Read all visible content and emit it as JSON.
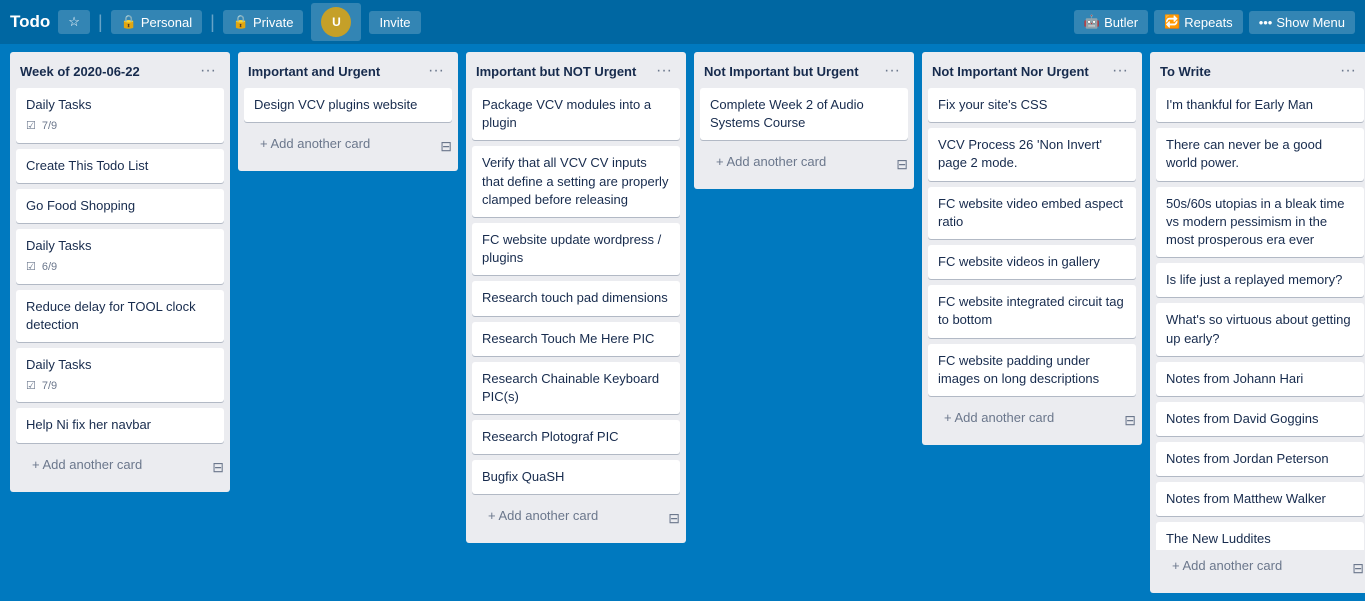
{
  "header": {
    "title": "Todo",
    "star_label": "★",
    "personal_label": "Personal",
    "private_label": "Private",
    "invite_label": "Invite",
    "butler_label": "Butler",
    "repeats_label": "Repeats",
    "show_menu_label": "Show Menu"
  },
  "columns": [
    {
      "id": "week",
      "title": "Week of 2020-06-22",
      "cards": [
        {
          "id": "c1",
          "text": "Daily Tasks",
          "meta": "7/9",
          "has_checklist": true
        },
        {
          "id": "c2",
          "text": "Create This Todo List",
          "meta": null,
          "has_checklist": false
        },
        {
          "id": "c3",
          "text": "Go Food Shopping",
          "meta": null,
          "has_checklist": false
        },
        {
          "id": "c4",
          "text": "Daily Tasks",
          "meta": "6/9",
          "has_checklist": true
        },
        {
          "id": "c5",
          "text": "Reduce delay for TOOL clock detection",
          "meta": null,
          "has_checklist": false
        },
        {
          "id": "c6",
          "text": "Daily Tasks",
          "meta": "7/9",
          "has_checklist": true
        },
        {
          "id": "c7",
          "text": "Help Ni fix her navbar",
          "meta": null,
          "has_checklist": false
        }
      ],
      "add_card_label": "+ Add another card"
    },
    {
      "id": "important-urgent",
      "title": "Important and Urgent",
      "cards": [
        {
          "id": "c8",
          "text": "Design VCV plugins website",
          "meta": null,
          "has_checklist": false
        }
      ],
      "add_card_label": "+ Add another card"
    },
    {
      "id": "important-not-urgent",
      "title": "Important but NOT Urgent",
      "cards": [
        {
          "id": "c9",
          "text": "Package VCV modules into a plugin",
          "meta": null,
          "has_checklist": false
        },
        {
          "id": "c10",
          "text": "Verify that all VCV CV inputs that define a setting are properly clamped before releasing",
          "meta": null,
          "has_checklist": false
        },
        {
          "id": "c11",
          "text": "FC website update wordpress / plugins",
          "meta": null,
          "has_checklist": false
        },
        {
          "id": "c12",
          "text": "Research touch pad dimensions",
          "meta": null,
          "has_checklist": false
        },
        {
          "id": "c13",
          "text": "Research Touch Me Here PIC",
          "meta": null,
          "has_checklist": false
        },
        {
          "id": "c14",
          "text": "Research Chainable Keyboard PIC(s)",
          "meta": null,
          "has_checklist": false
        },
        {
          "id": "c15",
          "text": "Research Plotograf PIC",
          "meta": null,
          "has_checklist": false
        },
        {
          "id": "c16",
          "text": "Bugfix QuaSH",
          "meta": null,
          "has_checklist": false
        }
      ],
      "add_card_label": "+ Add another card"
    },
    {
      "id": "not-important-urgent",
      "title": "Not Important but Urgent",
      "cards": [
        {
          "id": "c17",
          "text": "Complete Week 2 of Audio Systems Course",
          "meta": null,
          "has_checklist": false
        }
      ],
      "add_card_label": "+ Add another card"
    },
    {
      "id": "not-important-not-urgent",
      "title": "Not Important Nor Urgent",
      "cards": [
        {
          "id": "c18",
          "text": "Fix your site's CSS",
          "meta": null,
          "has_checklist": false
        },
        {
          "id": "c19",
          "text": "VCV Process 26 'Non Invert' page 2 mode.",
          "meta": null,
          "has_checklist": false
        },
        {
          "id": "c20",
          "text": "FC website video embed aspect ratio",
          "meta": null,
          "has_checklist": false
        },
        {
          "id": "c21",
          "text": "FC website videos in gallery",
          "meta": null,
          "has_checklist": false
        },
        {
          "id": "c22",
          "text": "FC website integrated circuit tag to bottom",
          "meta": null,
          "has_checklist": false
        },
        {
          "id": "c23",
          "text": "FC website padding under images on long descriptions",
          "meta": null,
          "has_checklist": false
        }
      ],
      "add_card_label": "+ Add another card"
    },
    {
      "id": "to-write",
      "title": "To Write",
      "cards": [
        {
          "id": "c24",
          "text": "I'm thankful for Early Man",
          "meta": null,
          "has_checklist": false
        },
        {
          "id": "c25",
          "text": "There can never be a good world power.",
          "meta": null,
          "has_checklist": false
        },
        {
          "id": "c26",
          "text": "50s/60s utopias in a bleak time vs modern pessimism in the most prosperous era ever",
          "meta": null,
          "has_checklist": false
        },
        {
          "id": "c27",
          "text": "Is life just a replayed memory?",
          "meta": null,
          "has_checklist": false
        },
        {
          "id": "c28",
          "text": "What's so virtuous about getting up early?",
          "meta": null,
          "has_checklist": false
        },
        {
          "id": "c29",
          "text": "Notes from Johann Hari",
          "meta": null,
          "has_checklist": false
        },
        {
          "id": "c30",
          "text": "Notes from David Goggins",
          "meta": null,
          "has_checklist": false
        },
        {
          "id": "c31",
          "text": "Notes from Jordan Peterson",
          "meta": null,
          "has_checklist": false
        },
        {
          "id": "c32",
          "text": "Notes from Matthew Walker",
          "meta": null,
          "has_checklist": false
        },
        {
          "id": "c33",
          "text": "The New Luddites",
          "meta": null,
          "has_checklist": false
        }
      ],
      "add_card_label": "+ Add another card"
    }
  ]
}
